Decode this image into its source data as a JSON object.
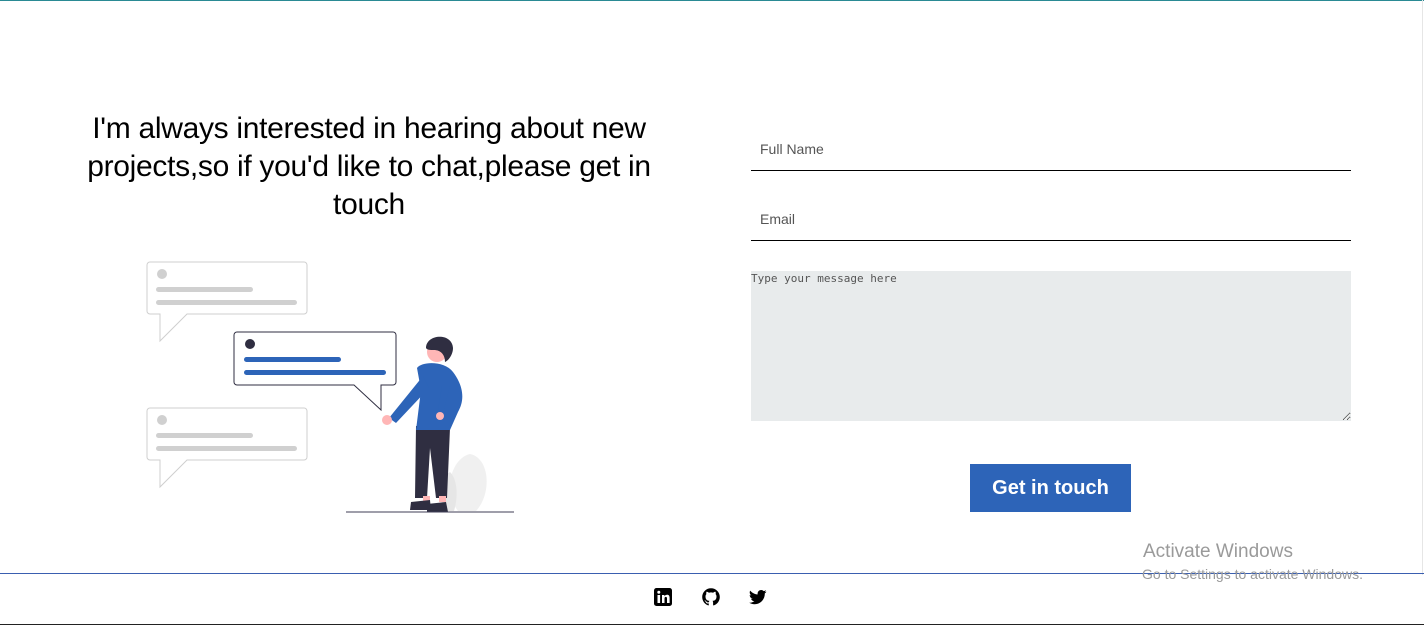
{
  "contact": {
    "headline": "I'm always interested in hearing about new projects,so if you'd like to chat,please get in touch"
  },
  "form": {
    "name_placeholder": "Full Name",
    "email_placeholder": "Email",
    "message_placeholder": "Type your message here",
    "submit_label": "Get in touch"
  },
  "footer": {
    "social": [
      "linkedin-icon",
      "github-icon",
      "twitter-icon"
    ]
  },
  "watermark": {
    "title": "Activate Windows",
    "subtitle": "Go to Settings to activate Windows."
  },
  "colors": {
    "accent": "#2d64b8",
    "textarea_bg": "#e8ebec",
    "footer_line": "#3a5fb0",
    "figure_dark": "#2f2e41"
  }
}
